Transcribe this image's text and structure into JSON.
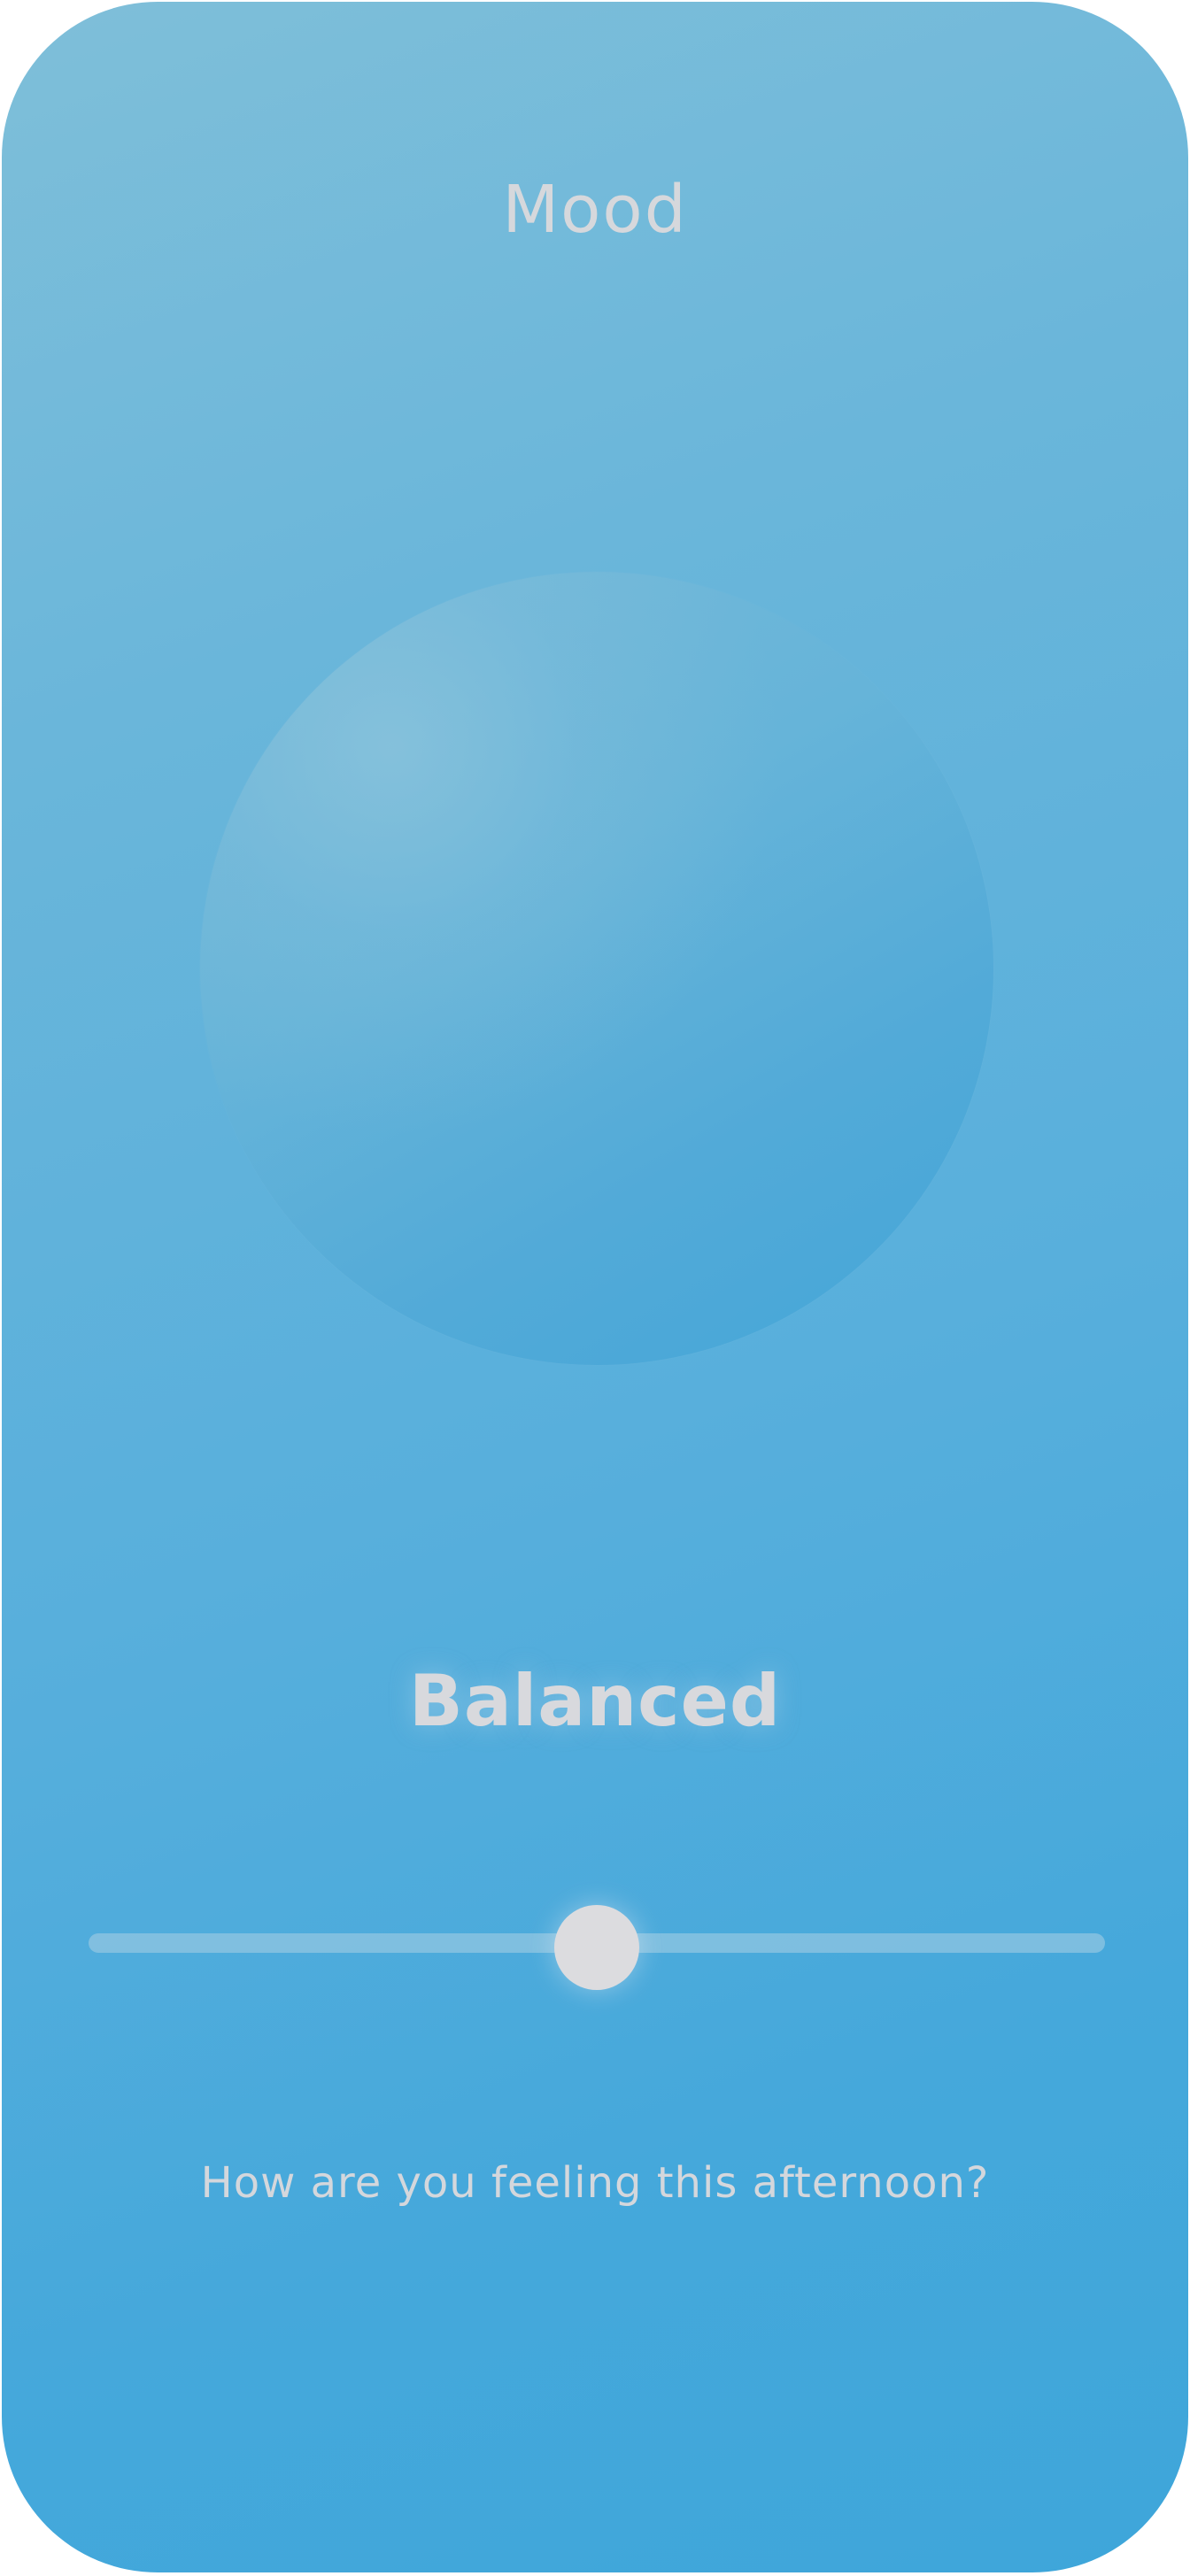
{
  "header": {
    "title": "Mood"
  },
  "mood": {
    "state_label": "Balanced",
    "slider_value": 0.5,
    "prompt": "How are you feeling this afternoon?"
  },
  "colors": {
    "background_top": "#7fbfd9",
    "background_bottom": "#3ea6da",
    "orb": "#5aaed8",
    "text": "#d6d8dc",
    "thumb": "#dcdcdf"
  }
}
